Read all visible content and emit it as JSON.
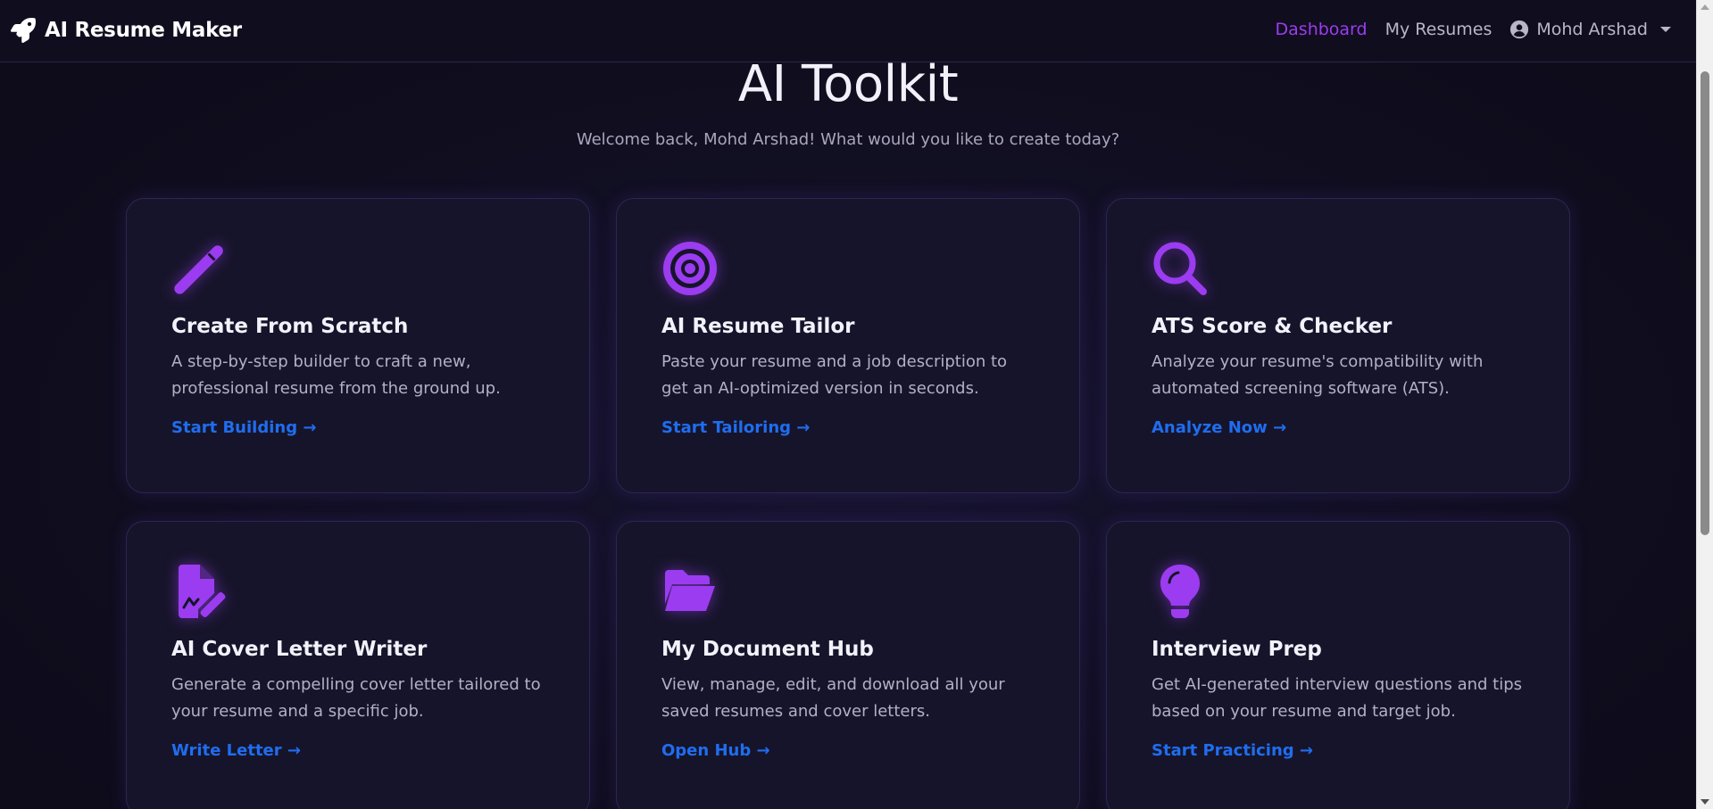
{
  "navbar": {
    "brand": "AI Resume Maker",
    "brand_icon": "rocket-icon",
    "links": {
      "dashboard": "Dashboard",
      "my_resumes": "My Resumes"
    },
    "user": {
      "name": "Mohd Arshad",
      "icon": "user-circle-icon"
    }
  },
  "header": {
    "title": "AI Toolkit",
    "subtitle": "Welcome back, Mohd Arshad! What would you like to create today?"
  },
  "cards": [
    {
      "icon": "magic-wand-icon",
      "title": "Create From Scratch",
      "description": "A step-by-step builder to craft a new, professional resume from the ground up.",
      "link": "Start Building →"
    },
    {
      "icon": "target-icon",
      "title": "AI Resume Tailor",
      "description": "Paste your resume and a job description to get an AI-optimized version in seconds.",
      "link": "Start Tailoring →"
    },
    {
      "icon": "magnifier-icon",
      "title": "ATS Score & Checker",
      "description": "Analyze your resume's compatibility with automated screening software (ATS).",
      "link": "Analyze Now →"
    },
    {
      "icon": "file-signature-icon",
      "title": "AI Cover Letter Writer",
      "description": "Generate a compelling cover letter tailored to your resume and a specific job.",
      "link": "Write Letter →"
    },
    {
      "icon": "folder-open-icon",
      "title": "My Document Hub",
      "description": "View, manage, edit, and download all your saved resumes and cover letters.",
      "link": "Open Hub →"
    },
    {
      "icon": "lightbulb-icon",
      "title": "Interview Prep",
      "description": "Get AI-generated interview questions and tips based on your resume and target job.",
      "link": "Start Practicing →"
    }
  ],
  "colors": {
    "accent": "#9b3cf0",
    "link": "#1f6df0",
    "background": "#100e1f",
    "card_background": "#16142a"
  }
}
